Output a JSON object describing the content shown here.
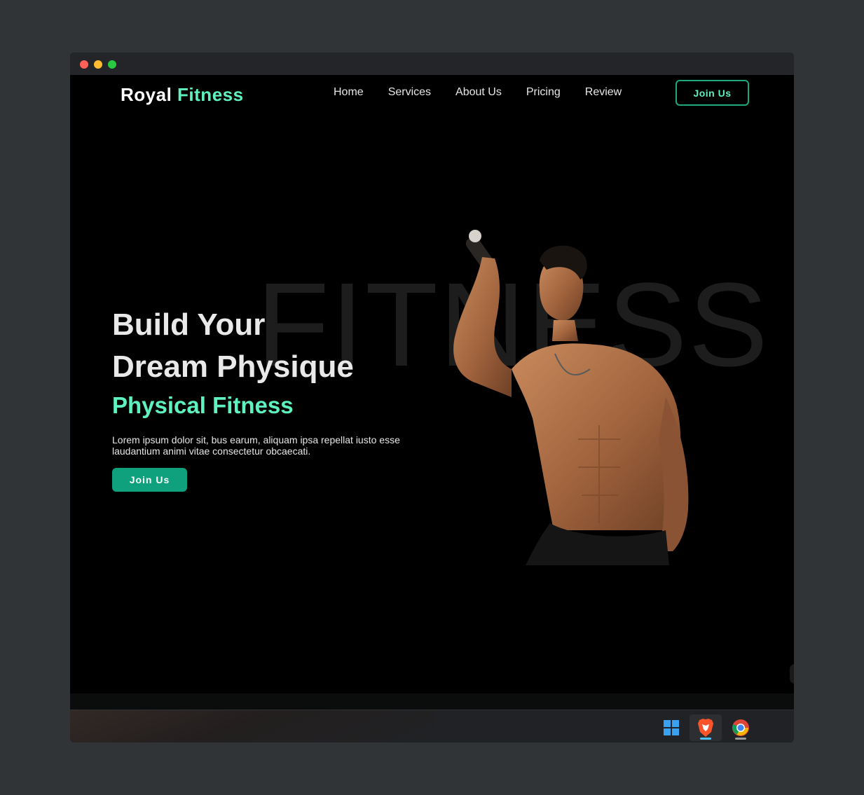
{
  "header": {
    "logo_main": "Royal",
    "logo_accent": "Fitness",
    "nav": [
      "Home",
      "Services",
      "About Us",
      "Pricing",
      "Review"
    ],
    "join_label": "Join Us"
  },
  "hero": {
    "background_word": "FITNESS",
    "title_line1": "Build Your",
    "title_line2": "Dream Physique",
    "subtitle": "Physical Fitness",
    "description": "Lorem ipsum dolor sit, bus earum, aliquam ipsa repellat iusto esse laudantium animi vitae consectetur obcaecati.",
    "join_label": "Join Us"
  },
  "taskbar": {
    "icons": [
      "windows-start-icon",
      "brave-browser-icon",
      "chrome-browser-icon"
    ]
  },
  "colors": {
    "accent": "#5ef2c0",
    "button": "#0fa07d",
    "background": "#000000"
  }
}
